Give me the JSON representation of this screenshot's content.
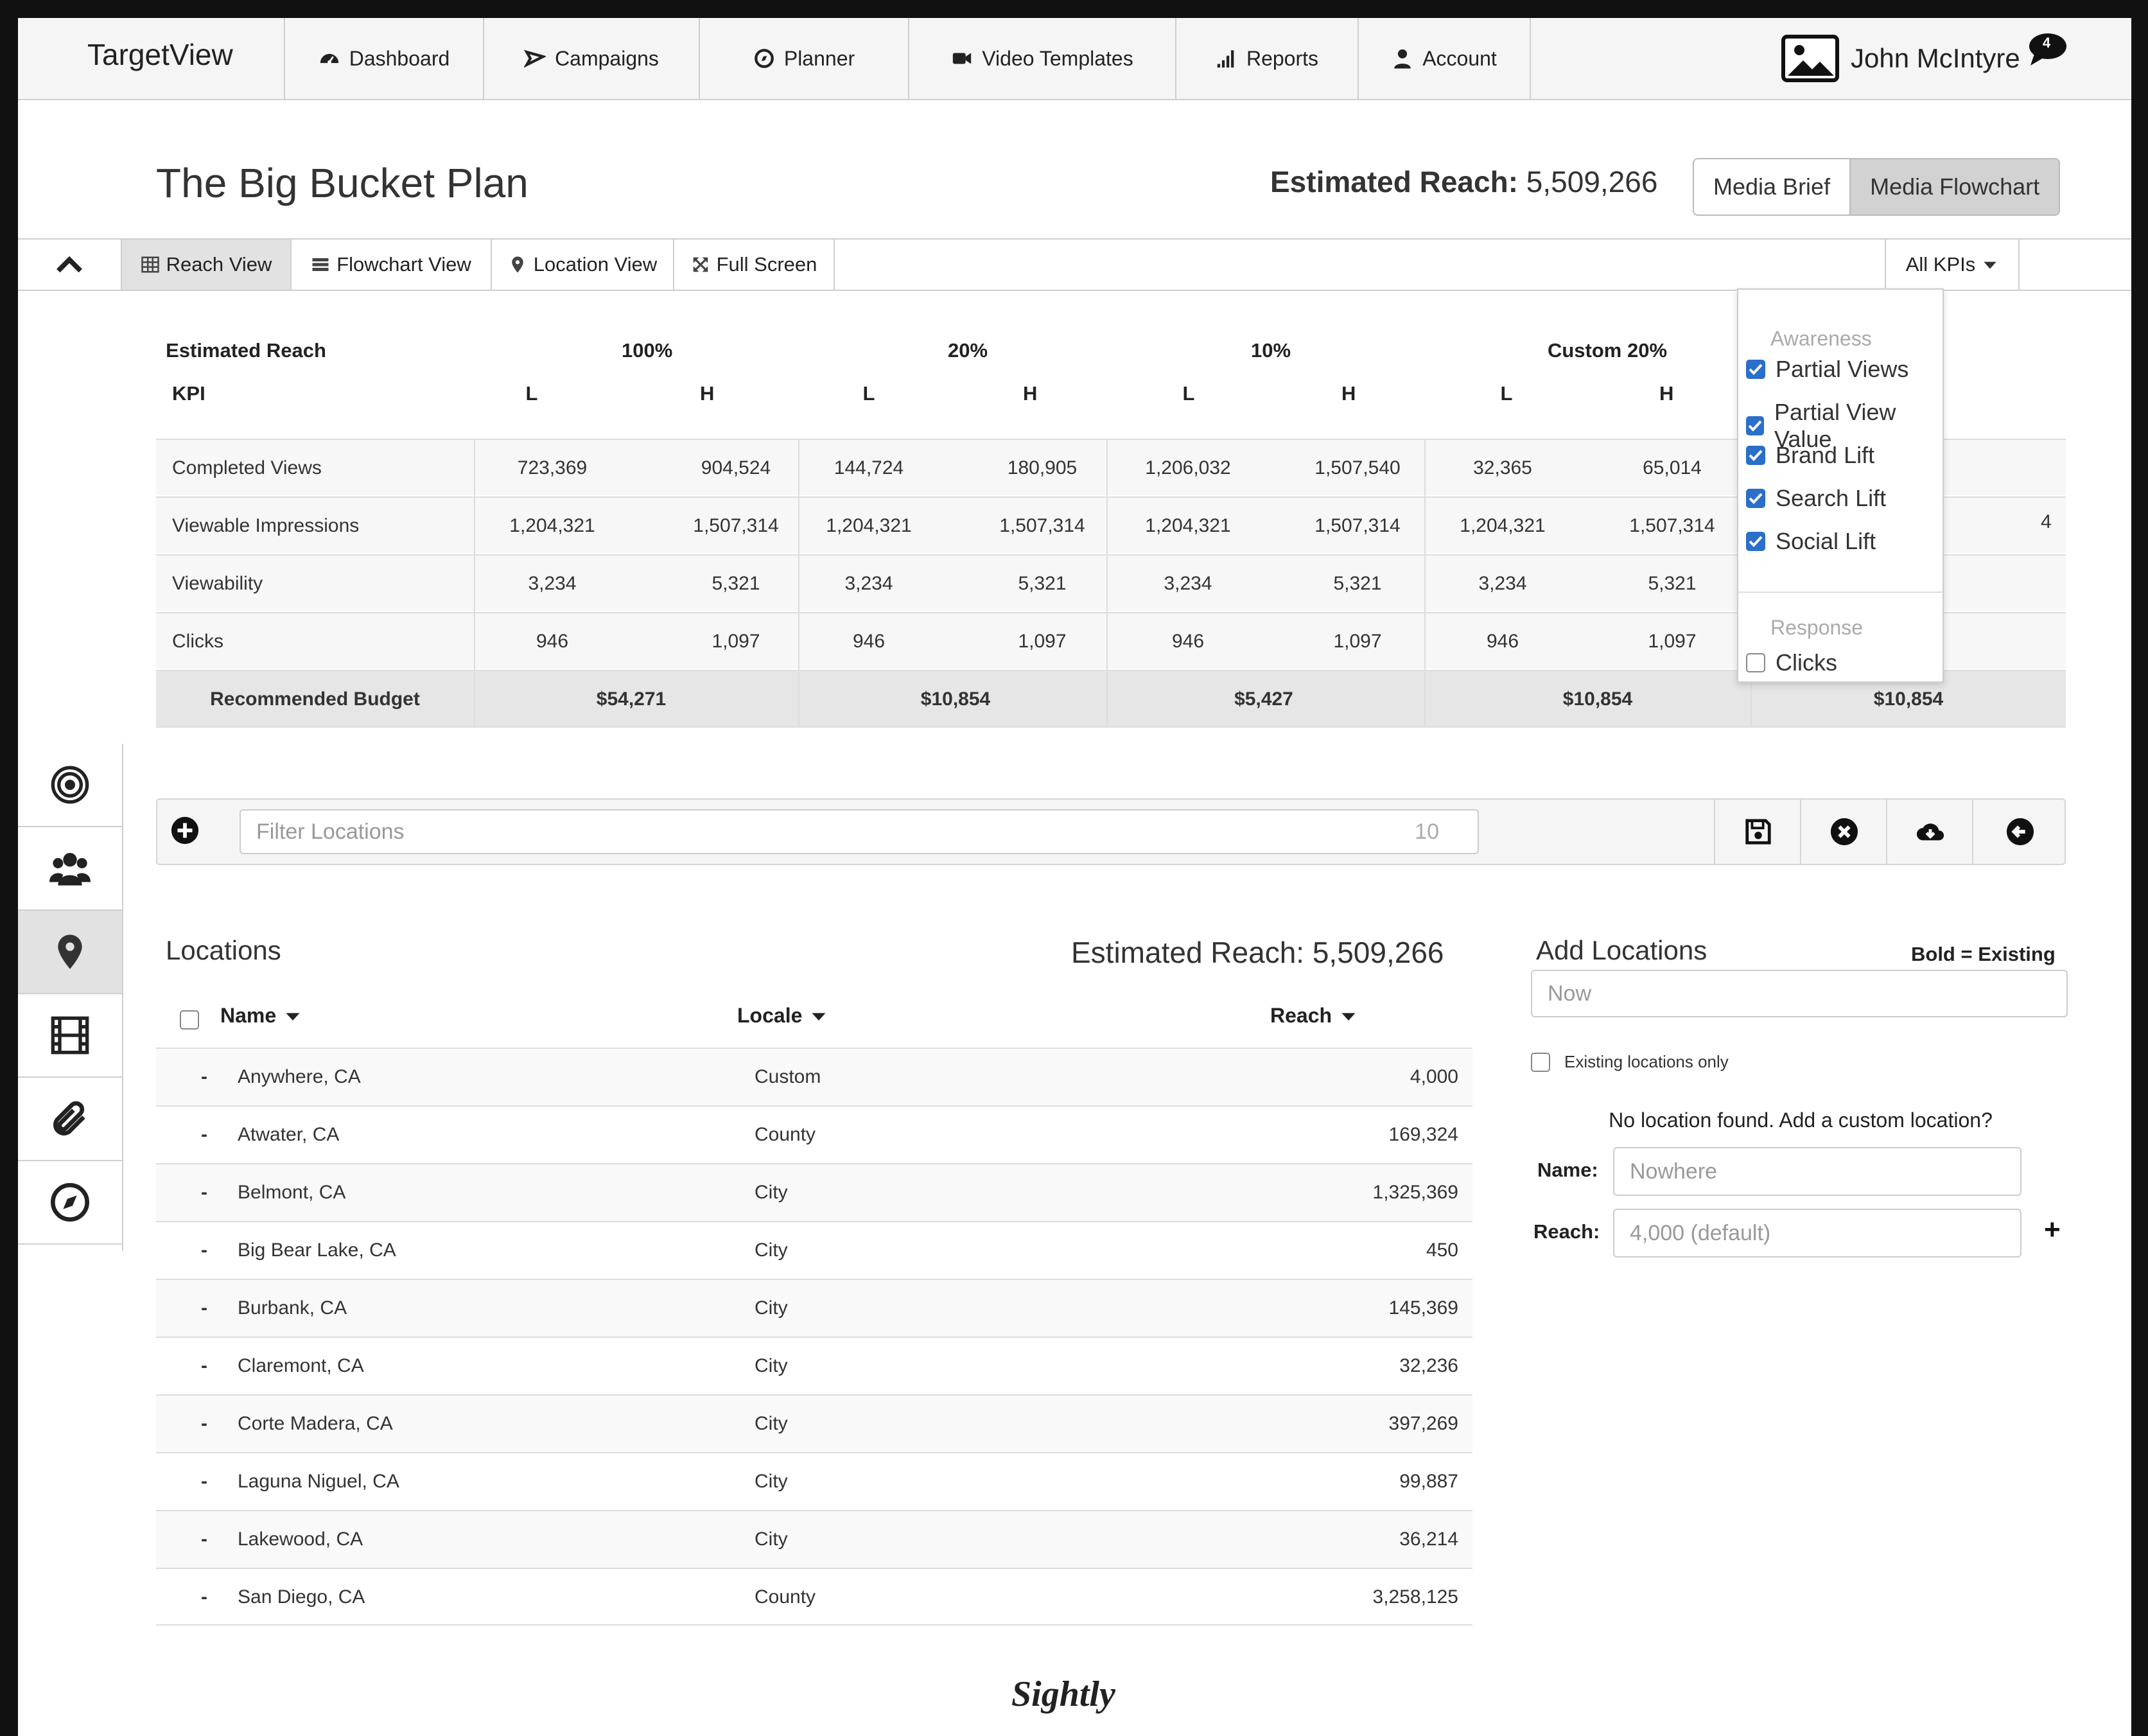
{
  "nav": {
    "brand": "TargetView",
    "items": [
      "Dashboard",
      "Campaigns",
      "Planner",
      "Video Templates",
      "Reports",
      "Account"
    ],
    "user": "John McIntyre",
    "notifications": "4"
  },
  "header": {
    "title": "The Big Bucket Plan",
    "reach_label": "Estimated Reach:",
    "reach_value": "5,509,266",
    "seg": [
      "Media Brief",
      "Media Flowchart"
    ]
  },
  "toolbar": {
    "views": [
      "Reach View",
      "Flowchart View",
      "Location View",
      "Full Screen"
    ],
    "kpi_select": "All KPIs"
  },
  "reach_table": {
    "corner": "Estimated Reach",
    "kpi_label": "KPI",
    "groups": [
      "100%",
      "20%",
      "10%",
      "Custom 20%"
    ],
    "lh": [
      "L",
      "H"
    ],
    "rows": [
      {
        "kpi": "Completed Views",
        "v": [
          "723,369",
          "904,524",
          "144,724",
          "180,905",
          "1,206,032",
          "1,507,540",
          "32,365",
          "65,014"
        ]
      },
      {
        "kpi": "Viewable Impressions",
        "v": [
          "1,204,321",
          "1,507,314",
          "1,204,321",
          "1,507,314",
          "1,204,321",
          "1,507,314",
          "1,204,321",
          "1,507,314"
        ]
      },
      {
        "kpi": "Viewability",
        "v": [
          "3,234",
          "5,321",
          "3,234",
          "5,321",
          "3,234",
          "5,321",
          "3,234",
          "5,321"
        ]
      },
      {
        "kpi": "Clicks",
        "v": [
          "946",
          "1,097",
          "946",
          "1,097",
          "946",
          "1,097",
          "946",
          "1,097"
        ]
      }
    ],
    "partial_col": [
      "4"
    ],
    "budget_label": "Recommended Budget",
    "budgets": [
      "$54,271",
      "$10,854",
      "$5,427",
      "$10,854",
      "$10,854"
    ]
  },
  "kpi_dropdown": {
    "group1": "Awareness",
    "items1": [
      {
        "label": "Partial Views",
        "checked": true
      },
      {
        "label": "Partial View Value",
        "checked": true
      },
      {
        "label": "Brand Lift",
        "checked": true
      },
      {
        "label": "Search Lift",
        "checked": true
      },
      {
        "label": "Social Lift",
        "checked": true
      }
    ],
    "group2": "Response",
    "items2": [
      {
        "label": "Clicks",
        "checked": false
      }
    ]
  },
  "filter": {
    "placeholder": "Filter Locations",
    "count": "10"
  },
  "locations": {
    "title": "Locations",
    "reach_label": "Estimated Reach:",
    "reach_value": "5,509,266",
    "columns": [
      "Name",
      "Locale",
      "Reach"
    ],
    "rows": [
      {
        "name": "Anywhere, CA",
        "locale": "Custom",
        "reach": "4,000"
      },
      {
        "name": "Atwater, CA",
        "locale": "County",
        "reach": "169,324"
      },
      {
        "name": "Belmont, CA",
        "locale": "City",
        "reach": "1,325,369"
      },
      {
        "name": "Big Bear Lake, CA",
        "locale": "City",
        "reach": "450"
      },
      {
        "name": "Burbank, CA",
        "locale": "City",
        "reach": "145,369"
      },
      {
        "name": "Claremont, CA",
        "locale": "City",
        "reach": "32,236"
      },
      {
        "name": "Corte Madera, CA",
        "locale": "City",
        "reach": "397,269"
      },
      {
        "name": "Laguna Niguel, CA",
        "locale": "City",
        "reach": "99,887"
      },
      {
        "name": "Lakewood, CA",
        "locale": "City",
        "reach": "36,214"
      },
      {
        "name": "San Diego, CA",
        "locale": "County",
        "reach": "3,258,125"
      }
    ],
    "row_marker": "-"
  },
  "add_locations": {
    "title": "Add Locations",
    "legend": "Bold = Existing",
    "search_value": "Now",
    "existing_only": "Existing locations only",
    "not_found": "No location found. Add a custom location?",
    "name_label": "Name:",
    "name_placeholder": "Nowhere",
    "reach_label": "Reach:",
    "reach_placeholder": "4,000 (default)",
    "add_symbol": "+"
  },
  "footer": {
    "logo": "Sightly"
  }
}
